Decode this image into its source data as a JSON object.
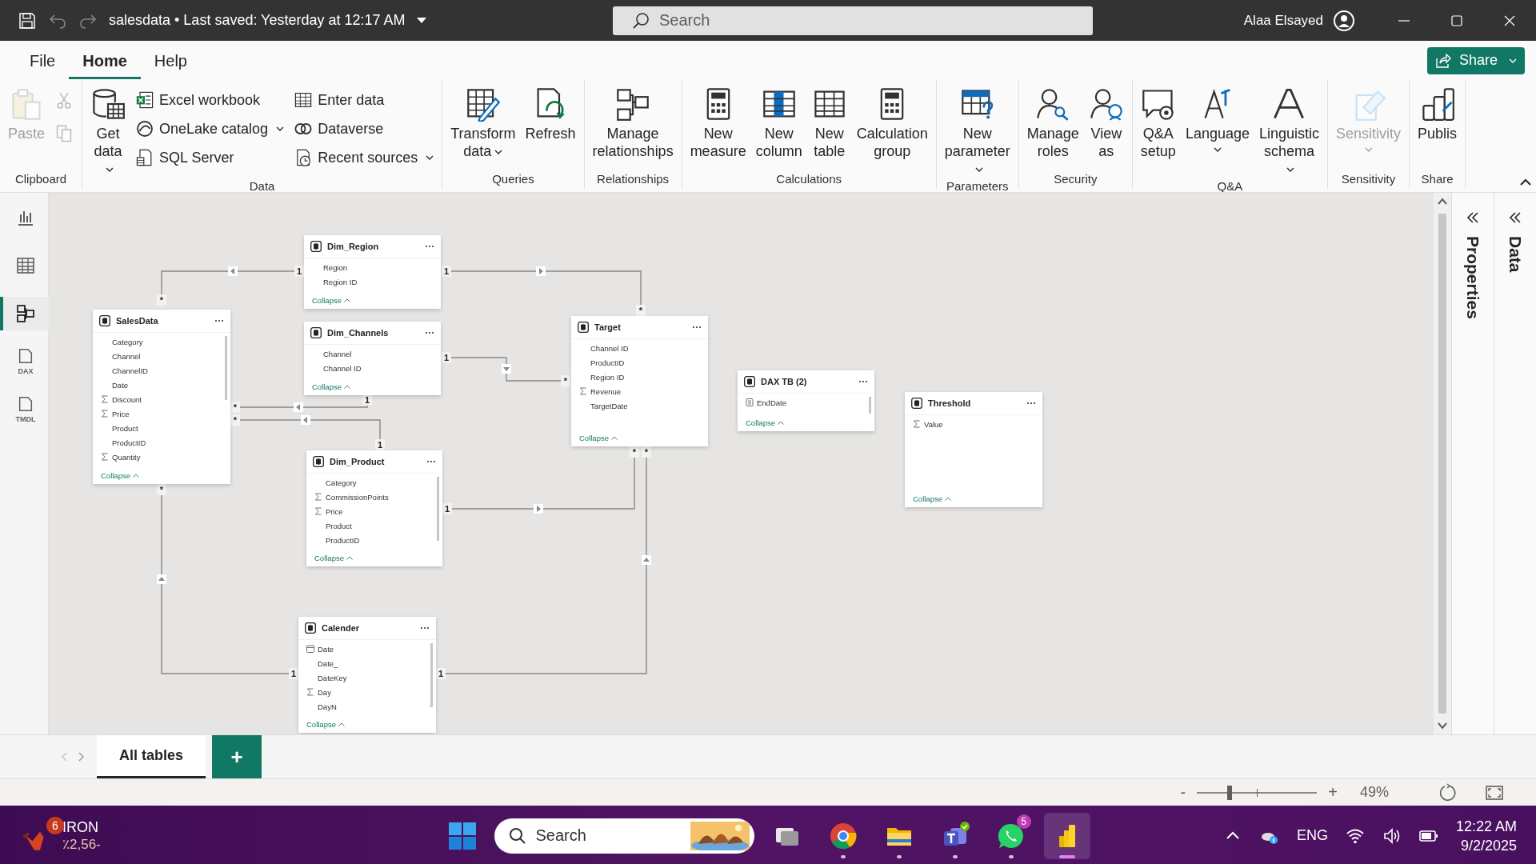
{
  "title_bar": {
    "document": "salesdata • Last saved: Yesterday at 12:17 AM",
    "search_placeholder": "Search",
    "user": "Alaa Elsayed"
  },
  "menu_tabs": [
    {
      "label": "File",
      "selected": false
    },
    {
      "label": "Home",
      "selected": true
    },
    {
      "label": "Help",
      "selected": false
    }
  ],
  "share_button": "Share",
  "ribbon_groups": [
    {
      "label": "Clipboard",
      "items": [
        {
          "kind": "large",
          "label": "Paste",
          "dropdown": false,
          "disabled": true
        },
        {
          "kind": "tool",
          "disabled": true
        },
        {
          "kind": "tool",
          "disabled": true
        }
      ]
    },
    {
      "label": "Data",
      "items": [
        {
          "kind": "large",
          "label": "Get data",
          "dropdown": true,
          "disabled": false
        },
        {
          "kind": "small",
          "label": "Excel workbook",
          "dropdown": false
        },
        {
          "kind": "small",
          "label": "OneLake catalog",
          "dropdown": true
        },
        {
          "kind": "small",
          "label": "SQL Server",
          "dropdown": false
        },
        {
          "kind": "small",
          "label": "Enter data",
          "dropdown": false
        },
        {
          "kind": "small",
          "label": "Dataverse",
          "dropdown": false
        },
        {
          "kind": "small",
          "label": "Recent sources",
          "dropdown": true
        }
      ]
    },
    {
      "label": "Queries",
      "items": [
        {
          "kind": "large",
          "label": "Transform data",
          "dropdown": true,
          "disabled": false
        },
        {
          "kind": "large",
          "label": "Refresh",
          "dropdown": false,
          "disabled": false
        }
      ]
    },
    {
      "label": "Relationships",
      "items": [
        {
          "kind": "large",
          "label": "Manage relationships",
          "dropdown": false,
          "disabled": false
        }
      ]
    },
    {
      "label": "Calculations",
      "items": [
        {
          "kind": "large",
          "label": "New measure",
          "dropdown": false,
          "disabled": false
        },
        {
          "kind": "large",
          "label": "New column",
          "dropdown": false,
          "disabled": false
        },
        {
          "kind": "large",
          "label": "New table",
          "dropdown": false,
          "disabled": false
        },
        {
          "kind": "large",
          "label": "Calculation group",
          "dropdown": false,
          "disabled": false
        }
      ]
    },
    {
      "label": "Parameters",
      "items": [
        {
          "kind": "large",
          "label": "New parameter",
          "dropdown": true,
          "disabled": false
        }
      ]
    },
    {
      "label": "Security",
      "items": [
        {
          "kind": "large",
          "label": "Manage roles",
          "dropdown": false,
          "disabled": false
        },
        {
          "kind": "large",
          "label": "View as",
          "dropdown": false,
          "disabled": false
        }
      ]
    },
    {
      "label": "Q&A",
      "items": [
        {
          "kind": "large",
          "label": "Q&A setup",
          "dropdown": false,
          "disabled": false
        },
        {
          "kind": "large",
          "label": "Language",
          "dropdown": true,
          "disabled": false
        },
        {
          "kind": "large",
          "label": "Linguistic schema",
          "dropdown": true,
          "disabled": false
        }
      ]
    },
    {
      "label": "Sensitivity",
      "items": [
        {
          "kind": "large",
          "label": "Sensitivity",
          "dropdown": true,
          "disabled": true
        }
      ]
    },
    {
      "label": "Share",
      "items": [
        {
          "kind": "large",
          "label": "Publis",
          "dropdown": false,
          "disabled": false
        }
      ]
    }
  ],
  "rail": [
    {
      "kind": "report",
      "selected": false
    },
    {
      "kind": "table",
      "selected": false
    },
    {
      "kind": "model",
      "selected": true
    },
    {
      "kind": "dax",
      "selected": false,
      "text": "DAX"
    },
    {
      "kind": "tmdl",
      "selected": false,
      "text": "TMDL"
    }
  ],
  "tables": [
    {
      "name": "Dim_Region",
      "fields": [
        {
          "name": "Region",
          "kind": "plain"
        },
        {
          "name": "Region ID",
          "kind": "plain"
        }
      ],
      "footer": "Collapse"
    },
    {
      "name": "SalesData",
      "fields": [
        {
          "name": "Category",
          "kind": "plain"
        },
        {
          "name": "Channel",
          "kind": "plain"
        },
        {
          "name": "ChannelID",
          "kind": "plain"
        },
        {
          "name": "Date",
          "kind": "plain"
        },
        {
          "name": "Discount",
          "kind": "sum"
        },
        {
          "name": "Price",
          "kind": "sum"
        },
        {
          "name": "Product",
          "kind": "plain"
        },
        {
          "name": "ProductID",
          "kind": "plain"
        },
        {
          "name": "Quantity",
          "kind": "sum"
        }
      ],
      "footer": "Collapse"
    },
    {
      "name": "Dim_Channels",
      "fields": [
        {
          "name": "Channel",
          "kind": "plain"
        },
        {
          "name": "Channel ID",
          "kind": "plain"
        }
      ],
      "footer": "Collapse"
    },
    {
      "name": "Target",
      "fields": [
        {
          "name": "Channel ID",
          "kind": "plain"
        },
        {
          "name": "ProductID",
          "kind": "plain"
        },
        {
          "name": "Region ID",
          "kind": "plain"
        },
        {
          "name": "Revenue",
          "kind": "sum"
        },
        {
          "name": "TargetDate",
          "kind": "plain"
        }
      ],
      "footer": "Collapse"
    },
    {
      "name": "DAX TB (2)",
      "fields": [
        {
          "name": "EndDate",
          "kind": "calculated"
        }
      ],
      "footer": "Collapse"
    },
    {
      "name": "Threshold",
      "fields": [
        {
          "name": "Value",
          "kind": "sum"
        }
      ],
      "footer": "Collapse"
    },
    {
      "name": "Dim_Product",
      "fields": [
        {
          "name": "Category",
          "kind": "plain"
        },
        {
          "name": "CommissionPoints",
          "kind": "sum"
        },
        {
          "name": "Price",
          "kind": "sum"
        },
        {
          "name": "Product",
          "kind": "plain"
        },
        {
          "name": "ProductID",
          "kind": "plain"
        }
      ],
      "footer": "Collapse"
    },
    {
      "name": "Calender",
      "fields": [
        {
          "name": "Date",
          "kind": "date"
        },
        {
          "name": "Date_",
          "kind": "plain"
        },
        {
          "name": "DateKey",
          "kind": "plain"
        },
        {
          "name": "Day",
          "kind": "sum"
        },
        {
          "name": "DayN",
          "kind": "plain"
        }
      ],
      "footer": "Collapse"
    }
  ],
  "relationships": [
    {
      "from_end": "*",
      "to_end": "1"
    },
    {
      "from_end": "1",
      "to_end": "*"
    },
    {
      "from_end": "*",
      "to_end": "1"
    },
    {
      "from_end": "1",
      "to_end": "*"
    },
    {
      "from_end": "*",
      "to_end": "1"
    },
    {
      "from_end": "1",
      "to_end": "*"
    },
    {
      "from_end": "*",
      "to_end": "1"
    },
    {
      "from_end": "1",
      "to_end": "*"
    }
  ],
  "side_panes": [
    {
      "label": "Properties"
    },
    {
      "label": "Data"
    }
  ],
  "page_tabs": [
    {
      "label": "All tables",
      "selected": true
    }
  ],
  "add_tab": "+",
  "zoom": {
    "minus": "-",
    "plus": "+",
    "level": 0.27,
    "reading": "49%"
  },
  "taskbar": {
    "widget": {
      "title": "IRON",
      "subtitle": "٪2,56-",
      "badge": "6"
    },
    "search_placeholder": "Search",
    "apps": [
      {
        "kind": "taskview",
        "running": false,
        "active": false
      },
      {
        "kind": "chrome",
        "running": true,
        "active": false
      },
      {
        "kind": "explorer",
        "running": true,
        "active": false
      },
      {
        "kind": "teams",
        "running": true,
        "active": false
      },
      {
        "kind": "whatsapp",
        "running": true,
        "active": false,
        "badge": "5"
      },
      {
        "kind": "powerbi",
        "running": true,
        "active": true
      }
    ],
    "language": "ENG",
    "time": "12:22 AM",
    "date": "9/2/2025"
  }
}
